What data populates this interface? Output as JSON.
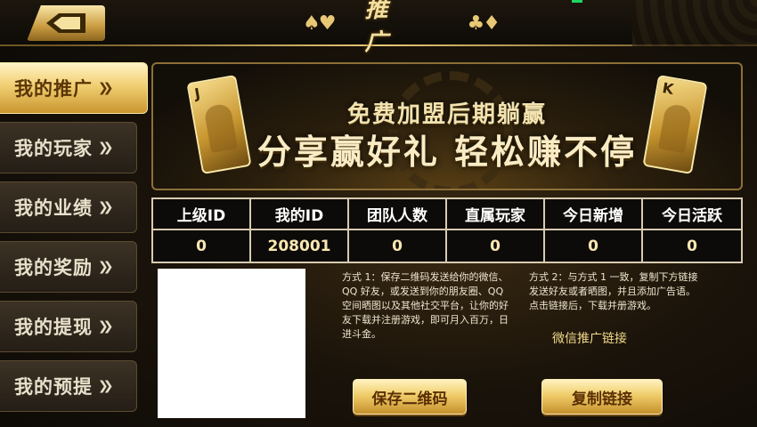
{
  "header": {
    "title": "推 广",
    "suit_left": "♠♥",
    "suit_right": "♣♦"
  },
  "sidebar": {
    "items": [
      {
        "label": "我的推广",
        "active": true
      },
      {
        "label": "我的玩家",
        "active": false
      },
      {
        "label": "我的业绩",
        "active": false
      },
      {
        "label": "我的奖励",
        "active": false
      },
      {
        "label": "我的提现",
        "active": false
      },
      {
        "label": "我的预提",
        "active": false
      }
    ],
    "arrow": "❯❯"
  },
  "banner": {
    "line1": "免费加盟后期躺赢",
    "line2": "分享赢好礼 轻松赚不停",
    "card_left_rank": "J",
    "card_right_rank": "K"
  },
  "stats": {
    "headers": [
      "上级ID",
      "我的ID",
      "团队人数",
      "直属玩家",
      "今日新增",
      "今日活跃"
    ],
    "values": [
      "0",
      "208001",
      "0",
      "0",
      "0",
      "0"
    ]
  },
  "methods": {
    "one": "方式 1：保存二维码发送给你的微信、QQ 好友，或发送到你的朋友圈、QQ 空间晒图以及其他社交平台，让你的好友下载并注册游戏，即可月入百万，日进斗金。",
    "two": "方式 2：与方式 1 一致，复制下方链接发送好友或者晒图，并且添加广告语。点击链接后，下载并册游戏。",
    "wechat_link": "微信推广链接"
  },
  "buttons": {
    "save_qr": "保存二维码",
    "copy_link": "复制链接"
  },
  "colors": {
    "gold": "#e8c775",
    "background": "#1a130a",
    "active_tab": "#f1cf72"
  }
}
